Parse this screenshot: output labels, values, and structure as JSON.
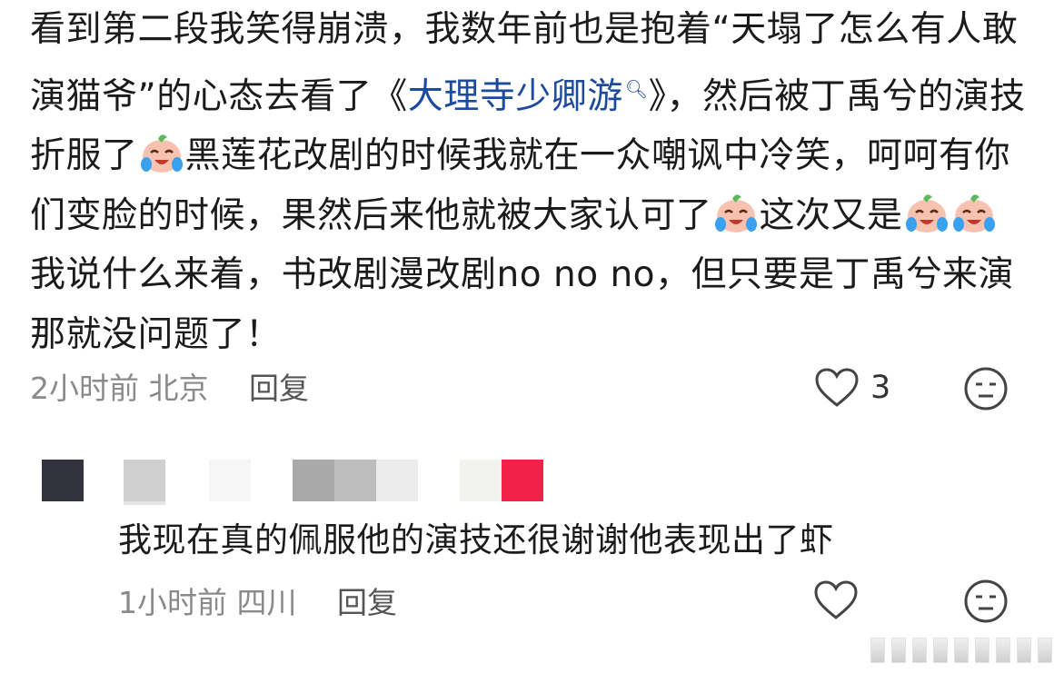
{
  "comment": {
    "seg1": "看到第二段我笑得崩溃，我数年前也是抱着“天塌了怎么有人敢演猫爷”的心态去看了《",
    "link": "大理寺少卿游",
    "seg2": "》，然后被丁禹兮的演技折服了",
    "seg3": "黑莲花改剧的时候我就在一众嘲讽中冷笑，呵呵有你们变脸的时候，果然后来他就被大家认可了",
    "seg4": "这次又是",
    "seg5": "我说什么来着，书改剧漫改剧no no no，但只要是丁禹兮来演那就没问题了！",
    "time": "2小时前",
    "location": "北京",
    "reply_label": "回复",
    "like_count": "3",
    "emoji_name": "crying-laughing-peach-icon"
  },
  "reply": {
    "text": "我现在真的佩服他的演技还很谢谢他表现出了虾",
    "time": "1小时前",
    "location": "四川",
    "reply_label": "回复"
  },
  "colors": {
    "link": "#1c4a9e",
    "meta": "#8a8a8a",
    "text": "#1b1b1b"
  }
}
